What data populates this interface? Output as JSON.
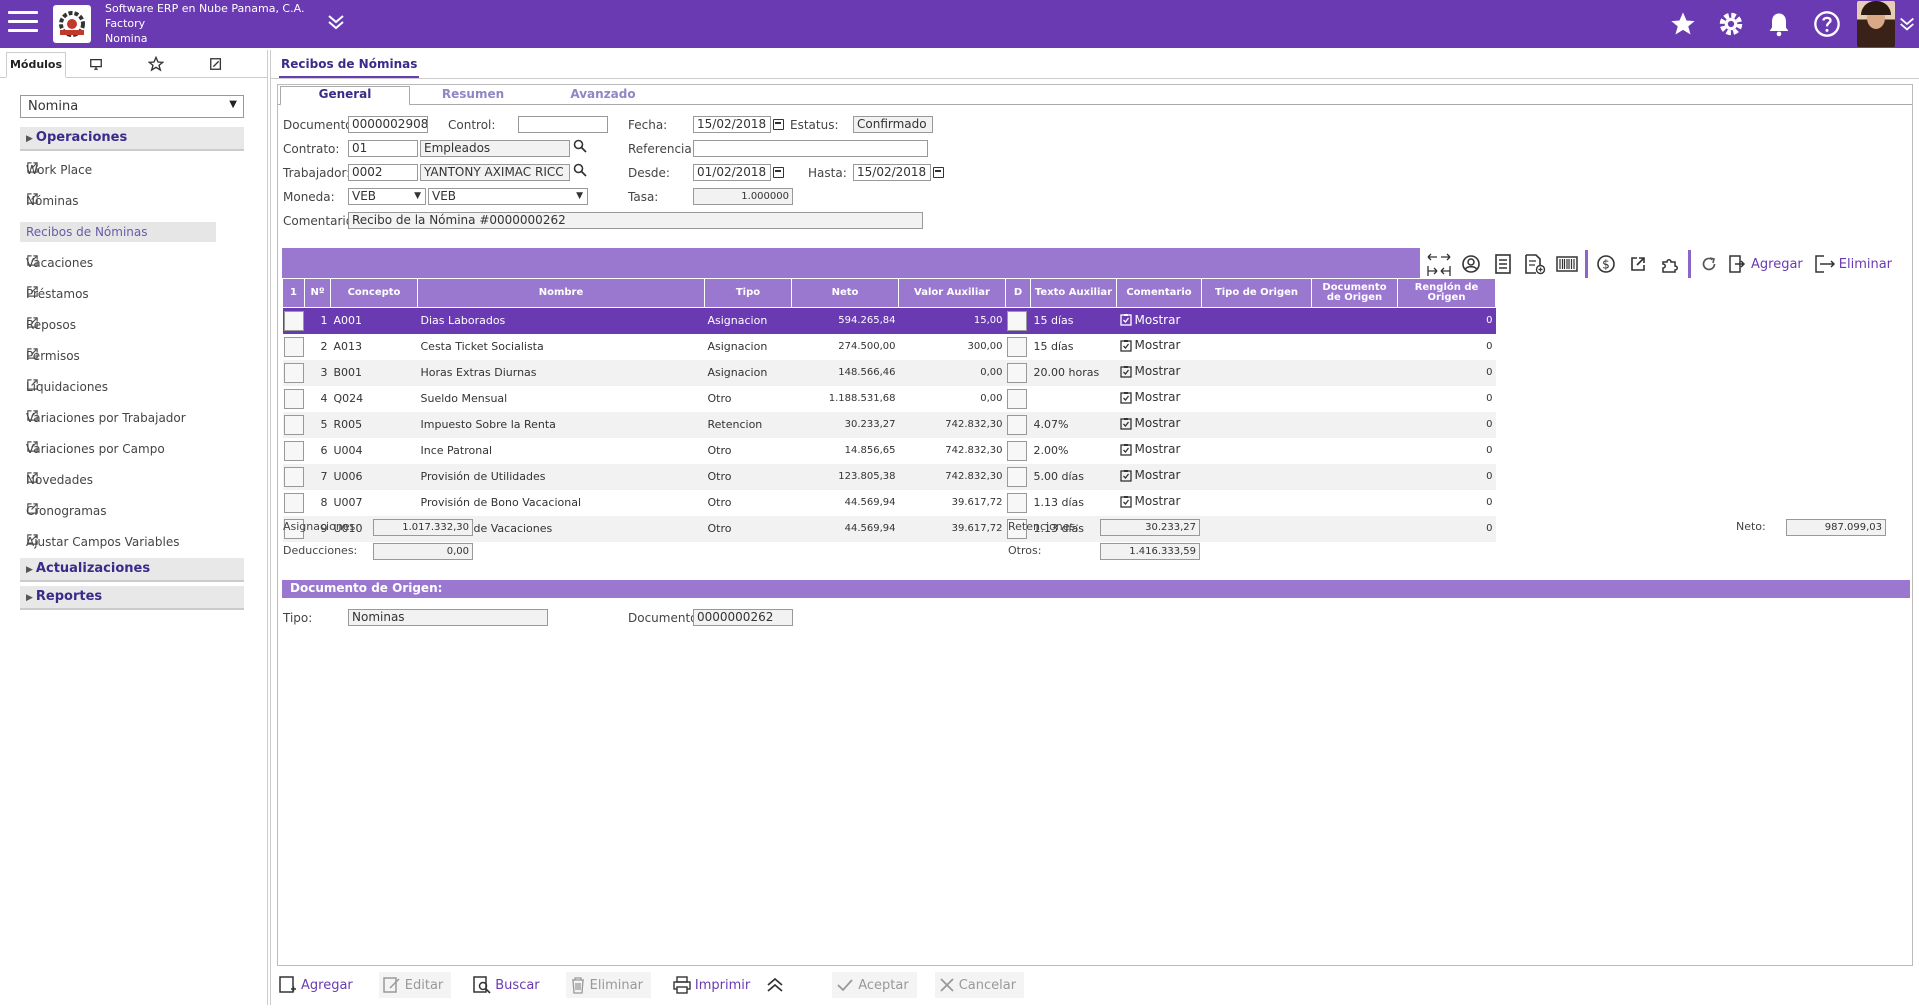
{
  "header": {
    "company": "Software ERP en Nube Panama, C.A.",
    "branch": "Factory",
    "module": "Nomina"
  },
  "sidebar": {
    "tabs": [
      "Módulos",
      "monitor-icon",
      "star-icon",
      "edit-icon"
    ],
    "module_select": "Nomina",
    "sections": {
      "operaciones": "Operaciones",
      "actualizaciones": "Actualizaciones",
      "reportes": "Reportes"
    },
    "items": [
      {
        "label": "Work Place"
      },
      {
        "label": "Nóminas"
      },
      {
        "label": "Recibos de Nóminas"
      },
      {
        "label": "Vacaciones"
      },
      {
        "label": "Préstamos"
      },
      {
        "label": "Reposos"
      },
      {
        "label": "Permisos"
      },
      {
        "label": "Liquidaciones"
      },
      {
        "label": "Variaciones por Trabajador"
      },
      {
        "label": "Variaciones por Campo"
      },
      {
        "label": "Novedades"
      },
      {
        "label": "Cronogramas"
      },
      {
        "label": "Ajustar Campos Variables"
      }
    ]
  },
  "page": {
    "tab": "Recibos de Nóminas",
    "subtabs": [
      "General",
      "Resumen",
      "Avanzado"
    ]
  },
  "form": {
    "documento_label": "Documento:",
    "documento": "0000002908",
    "control_label": "Control:",
    "control": "",
    "fecha_label": "Fecha:",
    "fecha": "15/02/2018",
    "estatus_label": "Estatus:",
    "estatus": "Confirmado",
    "contrato_label": "Contrato:",
    "contrato_code": "01",
    "contrato_name": "Empleados",
    "referencia_label": "Referencia:",
    "referencia": "",
    "trabajador_label": "Trabajador:",
    "trabajador_code": "0002",
    "trabajador_name": "YANTONY AXIMAC RICC",
    "desde_label": "Desde:",
    "desde": "01/02/2018",
    "hasta_label": "Hasta:",
    "hasta": "15/02/2018",
    "moneda_label": "Moneda:",
    "moneda_code": "VEB",
    "moneda_name": "VEB",
    "tasa_label": "Tasa:",
    "tasa": "1.000000",
    "comentario_label": "Comentario:",
    "comentario": "Recibo de la Nómina #0000000262"
  },
  "toolbar": {
    "agregar": "Agregar",
    "eliminar": "Eliminar"
  },
  "grid": {
    "headers": [
      "1",
      "Nº",
      "Concepto",
      "Nombre",
      "Tipo",
      "Neto",
      "Valor Auxiliar",
      "D",
      "Texto Auxiliar",
      "Comentario",
      "Tipo de Origen",
      "Documento de Origen",
      "Renglón de Origen"
    ],
    "rows": [
      {
        "n": "1",
        "concepto": "A001",
        "nombre": "Dias Laborados",
        "tipo": "Asignacion",
        "neto": "594.265,84",
        "aux": "15,00",
        "texto": "15 días",
        "coment": "Mostrar",
        "renglon": "0"
      },
      {
        "n": "2",
        "concepto": "A013",
        "nombre": "Cesta Ticket Socialista",
        "tipo": "Asignacion",
        "neto": "274.500,00",
        "aux": "300,00",
        "texto": "15 días",
        "coment": "Mostrar",
        "renglon": "0"
      },
      {
        "n": "3",
        "concepto": "B001",
        "nombre": "Horas Extras Diurnas",
        "tipo": "Asignacion",
        "neto": "148.566,46",
        "aux": "0,00",
        "texto": "20.00 horas",
        "coment": "Mostrar",
        "renglon": "0"
      },
      {
        "n": "4",
        "concepto": "Q024",
        "nombre": "Sueldo Mensual",
        "tipo": "Otro",
        "neto": "1.188.531,68",
        "aux": "0,00",
        "texto": "",
        "coment": "Mostrar",
        "renglon": "0"
      },
      {
        "n": "5",
        "concepto": "R005",
        "nombre": "Impuesto Sobre la Renta",
        "tipo": "Retencion",
        "neto": "30.233,27",
        "aux": "742.832,30",
        "texto": "4.07%",
        "coment": "Mostrar",
        "renglon": "0"
      },
      {
        "n": "6",
        "concepto": "U004",
        "nombre": "Ince Patronal",
        "tipo": "Otro",
        "neto": "14.856,65",
        "aux": "742.832,30",
        "texto": "2.00%",
        "coment": "Mostrar",
        "renglon": "0"
      },
      {
        "n": "7",
        "concepto": "U006",
        "nombre": "Provisión de Utilidades",
        "tipo": "Otro",
        "neto": "123.805,38",
        "aux": "742.832,30",
        "texto": "5.00 días",
        "coment": "Mostrar",
        "renglon": "0"
      },
      {
        "n": "8",
        "concepto": "U007",
        "nombre": "Provisión de Bono Vacacional",
        "tipo": "Otro",
        "neto": "44.569,94",
        "aux": "39.617,72",
        "texto": "1.13 días",
        "coment": "Mostrar",
        "renglon": "0"
      },
      {
        "n": "9",
        "concepto": "U010",
        "nombre": "Provisión de Vacaciones",
        "tipo": "Otro",
        "neto": "44.569,94",
        "aux": "39.617,72",
        "texto": "1.13 días",
        "coment": "Mostrar",
        "renglon": "0"
      }
    ]
  },
  "totals": {
    "asignaciones_label": "Asignaciones:",
    "asignaciones": "1.017.332,30",
    "deducciones_label": "Deducciones:",
    "deducciones": "0,00",
    "retenciones_label": "Retenciones:",
    "retenciones": "30.233,27",
    "otros_label": "Otros:",
    "otros": "1.416.333,59",
    "neto_label": "Neto:",
    "neto": "987.099,03"
  },
  "origen": {
    "title": "Documento de Origen:",
    "tipo_label": "Tipo:",
    "tipo": "Nominas",
    "documento_label": "Documento:",
    "documento": "0000000262"
  },
  "bottom": {
    "agregar": "Agregar",
    "editar": "Editar",
    "buscar": "Buscar",
    "eliminar": "Eliminar",
    "imprimir": "Imprimir",
    "aceptar": "Aceptar",
    "cancelar": "Cancelar"
  },
  "colors": {
    "brand": "#6a3ab3",
    "grid_header": "#9b78d0",
    "link": "#4a3b9b"
  }
}
